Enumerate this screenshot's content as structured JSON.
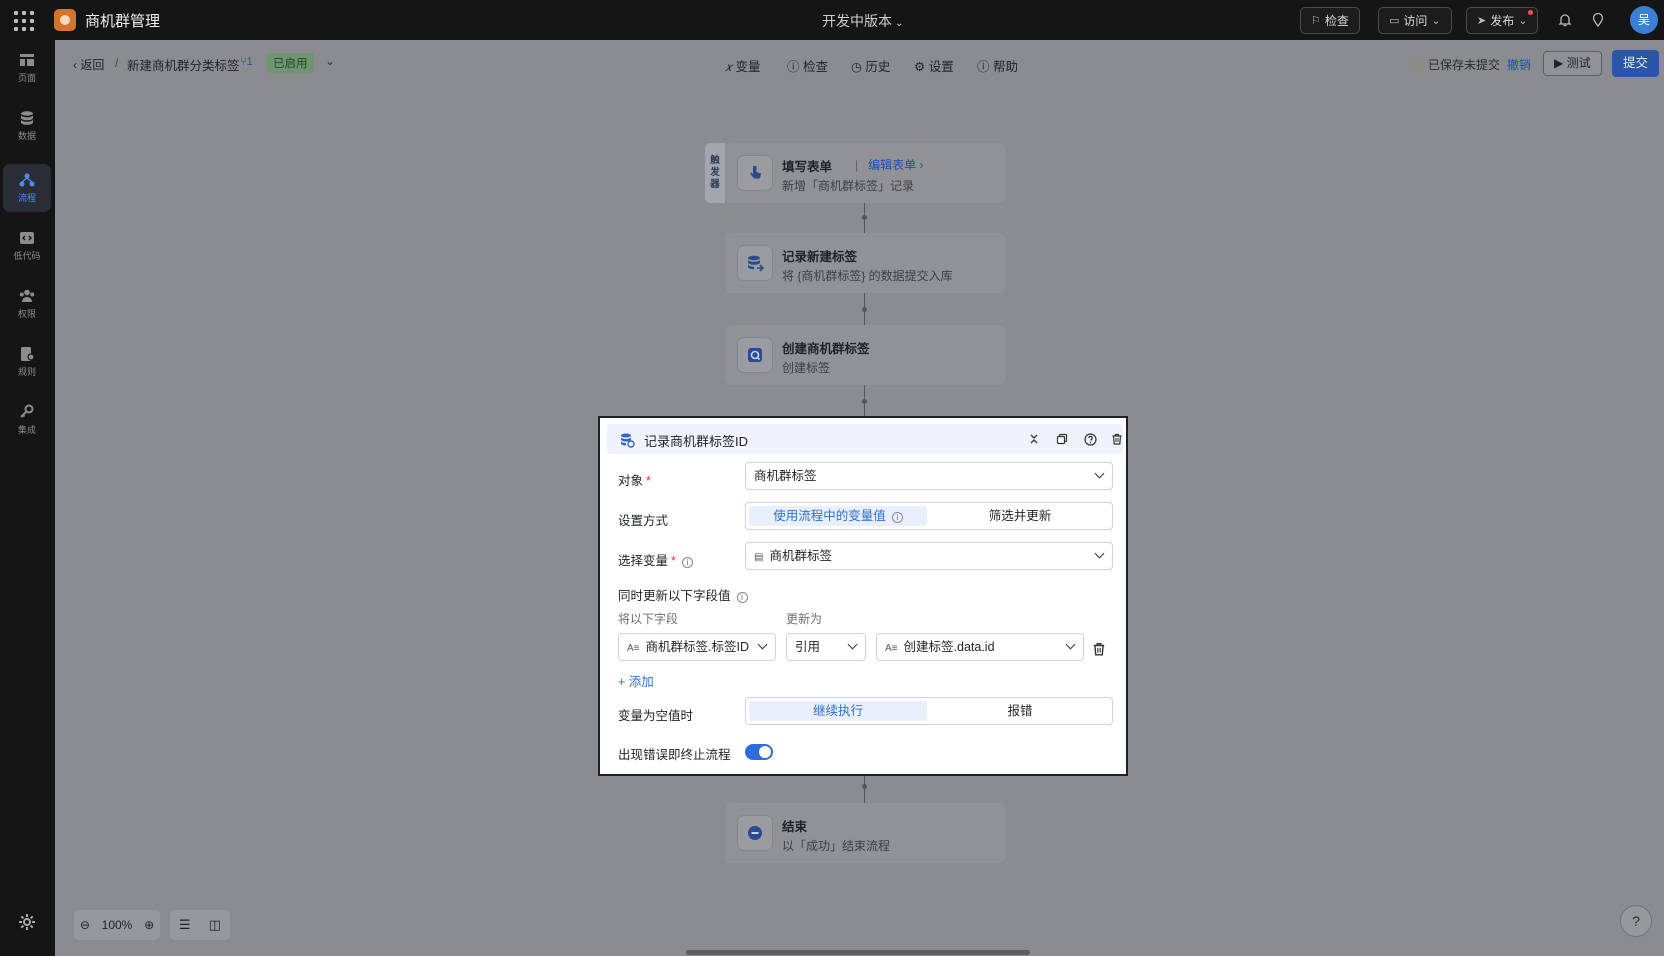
{
  "topbar": {
    "app_name": "商机群管理",
    "version_label": "开发中版本",
    "buttons": {
      "inspect": "检查",
      "visit": "访问",
      "publish": "发布"
    },
    "avatar_text": "吴"
  },
  "leftnav": {
    "items": [
      {
        "label": "页面",
        "icon": "page-icon"
      },
      {
        "label": "数据",
        "icon": "database-icon"
      },
      {
        "label": "流程",
        "icon": "flow-icon",
        "active": true
      },
      {
        "label": "低代码",
        "icon": "code-icon"
      },
      {
        "label": "权限",
        "icon": "users-icon"
      },
      {
        "label": "规则",
        "icon": "rule-icon"
      },
      {
        "label": "集成",
        "icon": "key-icon"
      }
    ]
  },
  "subheader": {
    "back_label": "返回",
    "breadcrumb_sep": "/",
    "flow_title": "新建商机群分类标签",
    "version_count": "1",
    "status": "已启用",
    "tools": {
      "variables": "变量",
      "inspect": "检查",
      "history": "历史",
      "settings": "设置",
      "help": "帮助"
    },
    "saved_tip": "已保存未提交",
    "undo_label": "撤销",
    "test_label": "测试",
    "submit_label": "提交"
  },
  "canvas": {
    "trigger_tag": "触发器",
    "nodes": [
      {
        "title": "填写表单",
        "subtitle": "新增「商机群标签」记录",
        "link": "编辑表单"
      },
      {
        "title": "记录新建标签",
        "subtitle": "将 {商机群标签} 的数据提交入库"
      },
      {
        "title": "创建商机群标签",
        "subtitle": "创建标签"
      },
      {
        "title": "结束",
        "subtitle": "以「成功」结束流程"
      }
    ],
    "zoom": "100%"
  },
  "panel": {
    "title": "记录商机群标签ID",
    "object_label": "对象",
    "object_value": "商机群标签",
    "mode_label": "设置方式",
    "mode_options": [
      "使用流程中的变量值",
      "筛选并更新"
    ],
    "variable_label": "选择变量",
    "variable_value": "商机群标签",
    "update_label": "同时更新以下字段值",
    "col_field": "将以下字段",
    "col_to": "更新为",
    "row": {
      "field": "商机群标签.标签ID",
      "type": "引用",
      "value": "创建标签.data.id"
    },
    "add_label": "添加",
    "empty_label": "变量为空值时",
    "empty_options": [
      "继续执行",
      "报错"
    ],
    "terminate_label": "出现错误即终止流程",
    "terminate_on": true
  },
  "colors": {
    "accent": "#2f6ddf",
    "topbar_bg": "#151515",
    "status_green": "#6f9572"
  }
}
